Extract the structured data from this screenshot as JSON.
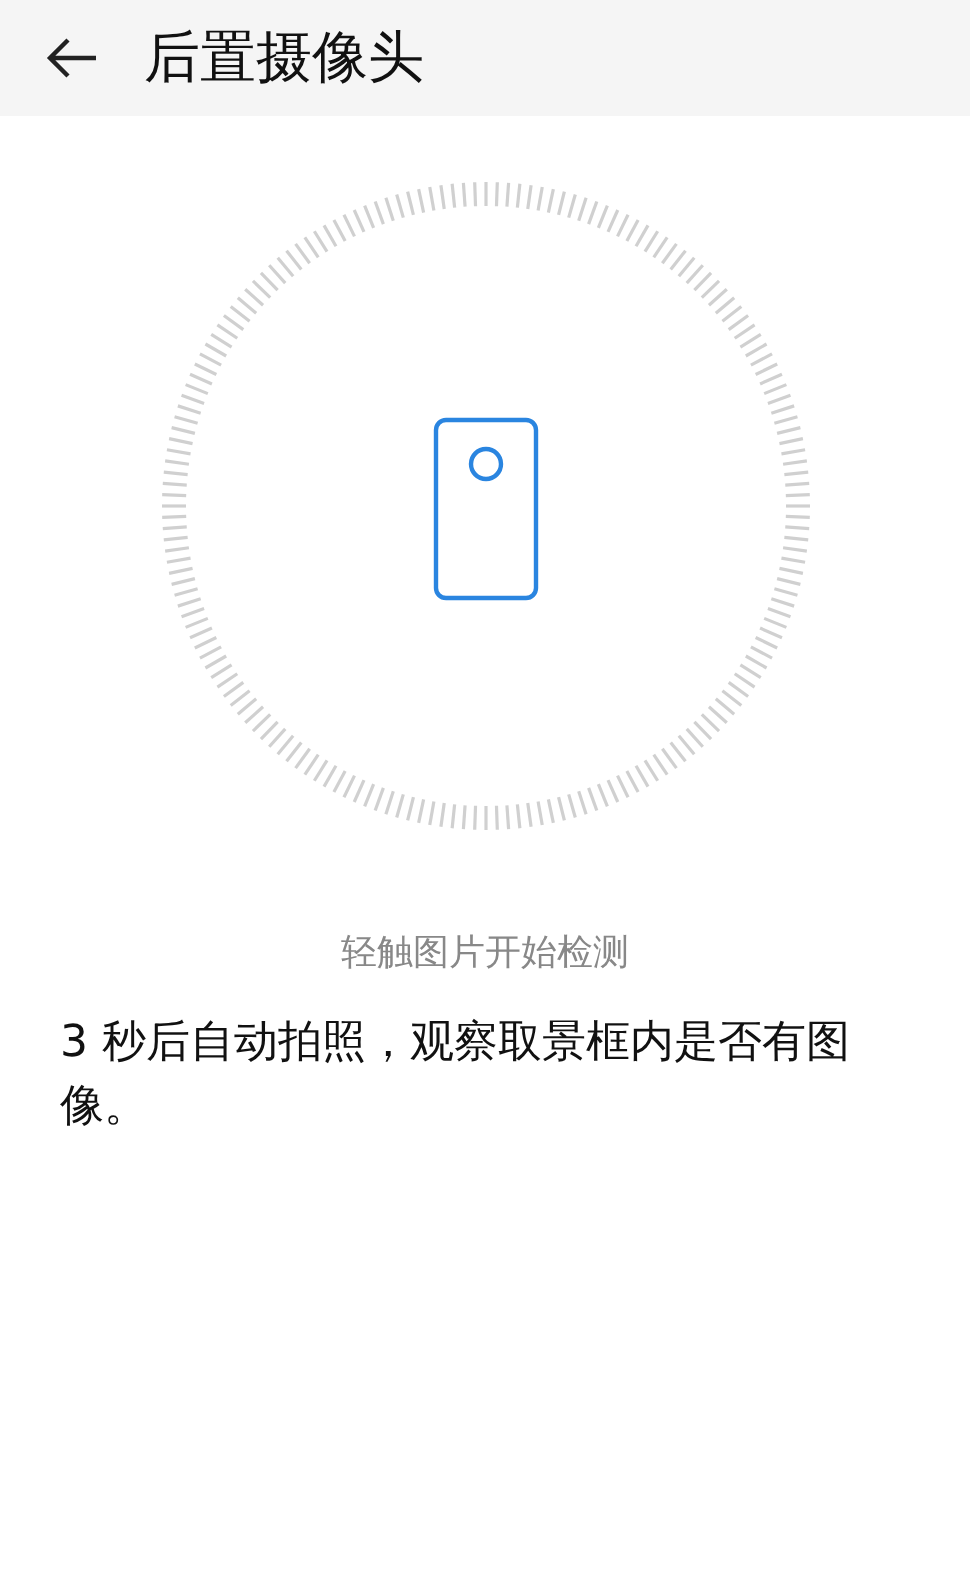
{
  "header": {
    "title": "后置摄像头"
  },
  "hint": "轻触图片开始检测",
  "description": "3 秒后自动拍照，观察取景框内是否有图像。"
}
